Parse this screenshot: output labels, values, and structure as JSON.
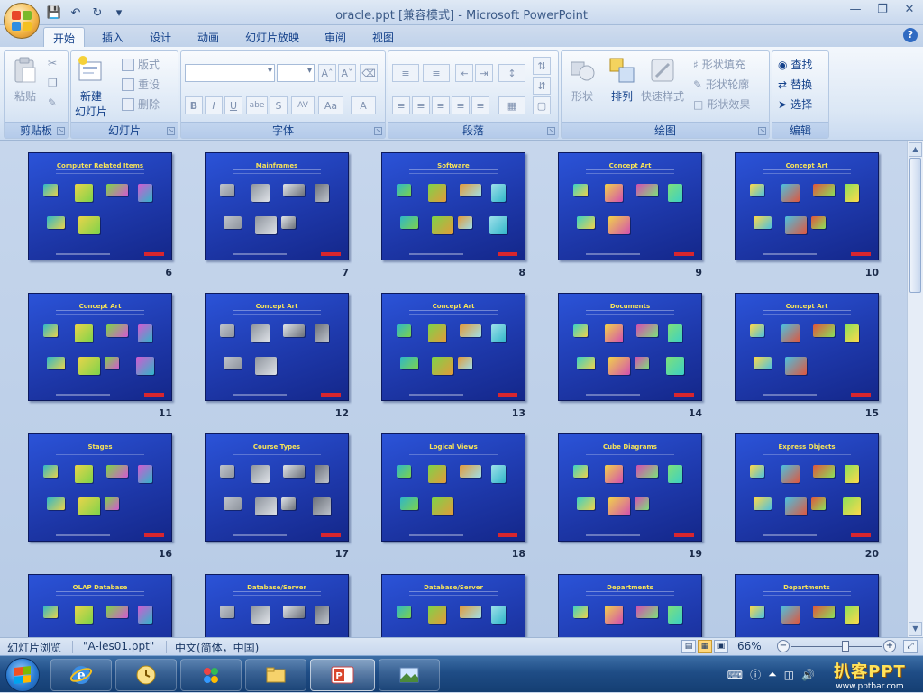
{
  "window": {
    "title": "oracle.ppt [兼容模式] - Microsoft PowerPoint"
  },
  "qat": {
    "icons": [
      "save-icon",
      "undo-icon",
      "redo-icon",
      "customize-icon"
    ]
  },
  "tabs": [
    {
      "label": "开始",
      "active": true
    },
    {
      "label": "插入"
    },
    {
      "label": "设计"
    },
    {
      "label": "动画"
    },
    {
      "label": "幻灯片放映"
    },
    {
      "label": "审阅"
    },
    {
      "label": "视图"
    }
  ],
  "ribbon": {
    "clipboard": {
      "label": "剪贴板",
      "paste": "粘贴"
    },
    "slides": {
      "label": "幻灯片",
      "new_slide_1": "新建",
      "new_slide_2": "幻灯片",
      "layout": "版式",
      "reset": "重设",
      "delete": "删除"
    },
    "font": {
      "label": "字体",
      "buttons": [
        "B",
        "I",
        "U",
        "abe",
        "S",
        "AV",
        "Aa",
        "A"
      ]
    },
    "paragraph": {
      "label": "段落"
    },
    "drawing": {
      "label": "绘图",
      "shape": "形状",
      "arrange": "排列",
      "quick_styles": "快速样式",
      "fill": "形状填充",
      "outline": "形状轮廓",
      "effects": "形状效果"
    },
    "editing": {
      "label": "编辑",
      "find": "查找",
      "replace": "替换",
      "select": "选择"
    }
  },
  "slides": [
    {
      "num": "6",
      "title": "Computer Related Items"
    },
    {
      "num": "7",
      "title": "Mainframes"
    },
    {
      "num": "8",
      "title": "Software"
    },
    {
      "num": "9",
      "title": "Concept Art"
    },
    {
      "num": "10",
      "title": "Concept Art"
    },
    {
      "num": "11",
      "title": "Concept Art"
    },
    {
      "num": "12",
      "title": "Concept Art"
    },
    {
      "num": "13",
      "title": "Concept Art"
    },
    {
      "num": "14",
      "title": "Documents"
    },
    {
      "num": "15",
      "title": "Concept Art"
    },
    {
      "num": "16",
      "title": "Stages"
    },
    {
      "num": "17",
      "title": "Course Types"
    },
    {
      "num": "18",
      "title": "Logical Views"
    },
    {
      "num": "19",
      "title": "Cube Diagrams"
    },
    {
      "num": "20",
      "title": "Express Objects"
    },
    {
      "num": "",
      "title": "OLAP Database"
    },
    {
      "num": "",
      "title": "Database/Server"
    },
    {
      "num": "",
      "title": "Database/Server"
    },
    {
      "num": "",
      "title": "Departments"
    },
    {
      "num": "",
      "title": "Departments"
    }
  ],
  "status": {
    "view": "幻灯片浏览",
    "file": "\"A-les01.ppt\"",
    "lang": "中文(简体，中国)",
    "zoom": "66%"
  },
  "taskbar": {
    "brand": "扒客PPT",
    "brand_url": "www.pptbar.com"
  },
  "colors": {
    "slide_bg": "#1d37a8",
    "slide_title": "#f6e35a",
    "accent": "#d8262e"
  }
}
